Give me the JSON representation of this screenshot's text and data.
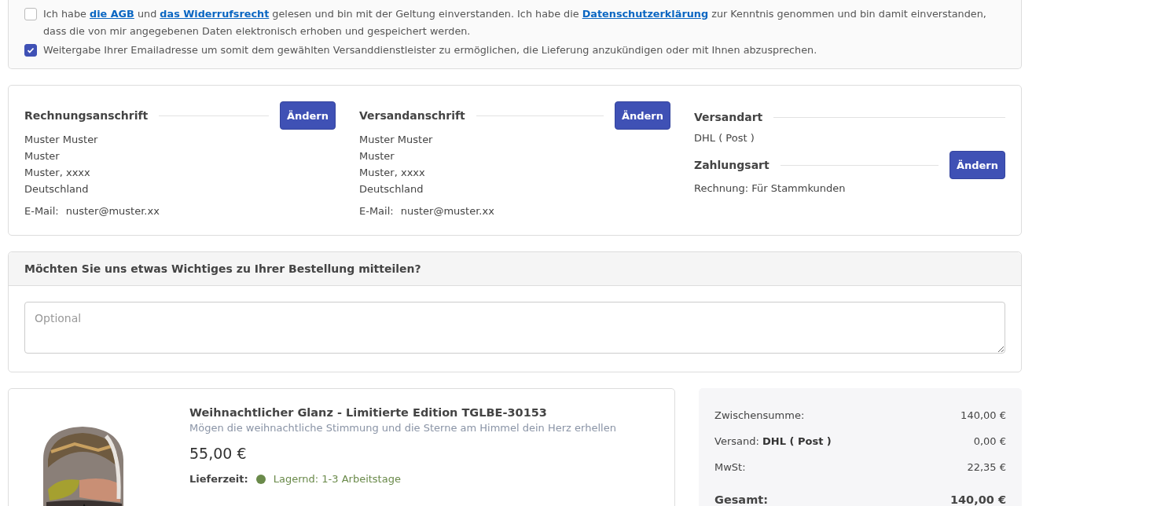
{
  "consents": [
    {
      "checked": false,
      "parts": [
        {
          "kind": "text",
          "text": "Ich habe "
        },
        {
          "kind": "link",
          "text": "die AGB"
        },
        {
          "kind": "text",
          "text": " und "
        },
        {
          "kind": "link",
          "text": "das Widerrufsrecht"
        },
        {
          "kind": "text",
          "text": " gelesen und bin mit der Geltung einverstanden. Ich habe die "
        },
        {
          "kind": "link",
          "text": "Datenschutzerklärung"
        },
        {
          "kind": "text",
          "text": " zur Kenntnis genommen und bin damit einverstanden, dass die von mir angegebenen Daten elektronisch erhoben und gespeichert werden."
        }
      ]
    },
    {
      "checked": true,
      "parts": [
        {
          "kind": "text",
          "text": "Weitergabe Ihrer Emailadresse um somit dem gewählten Versanddienstleister zu ermöglichen, die Lieferung anzukündigen oder mit Ihnen abzusprechen."
        }
      ]
    }
  ],
  "addresses": [
    {
      "title": "Rechnungsanschrift",
      "button": "Ändern",
      "lines": [
        "Muster Muster",
        "Muster",
        "Muster, xxxx",
        "Deutschland"
      ],
      "email_label": "E-Mail:",
      "email": "nuster@muster.xx"
    },
    {
      "title": "Versandanschrift",
      "button": "Ändern",
      "lines": [
        "Muster Muster",
        "Muster",
        "Muster, xxxx",
        "Deutschland"
      ],
      "email_label": "E-Mail:",
      "email": "nuster@muster.xx"
    }
  ],
  "shipping": {
    "title": "Versandart",
    "value": "DHL ( Post )"
  },
  "payment": {
    "title": "Zahlungsart",
    "button": "Ändern",
    "value": "Rechnung: Für Stammkunden"
  },
  "note": {
    "title": "Möchten Sie uns etwas Wichtiges zu Ihrer Bestellung mitteilen?",
    "placeholder": "Optional"
  },
  "product": {
    "name": "Weihnachtlicher Glanz - Limitierte Edition TGLBE-30153",
    "description": "Mögen die weihnachtliche Stimmung und die Sterne am Himmel dein Herz erhellen",
    "price": "55,00 €",
    "delivery": {
      "label": "Lieferzeit:",
      "text": "Lagernd: 1-3 Arbeitstage",
      "color": "#6a8a4a"
    }
  },
  "summary": [
    {
      "kind": "plain",
      "label": "Zwischensumme:",
      "value": "140,00 €"
    },
    {
      "kind": "shipping",
      "label": "Versand:",
      "method": "DHL ( Post )",
      "value": "0,00 €"
    },
    {
      "kind": "plain",
      "label": "MwSt:",
      "value": "22,35 €"
    },
    {
      "kind": "total",
      "label": "Gesamt:",
      "value": "140,00 €"
    }
  ]
}
